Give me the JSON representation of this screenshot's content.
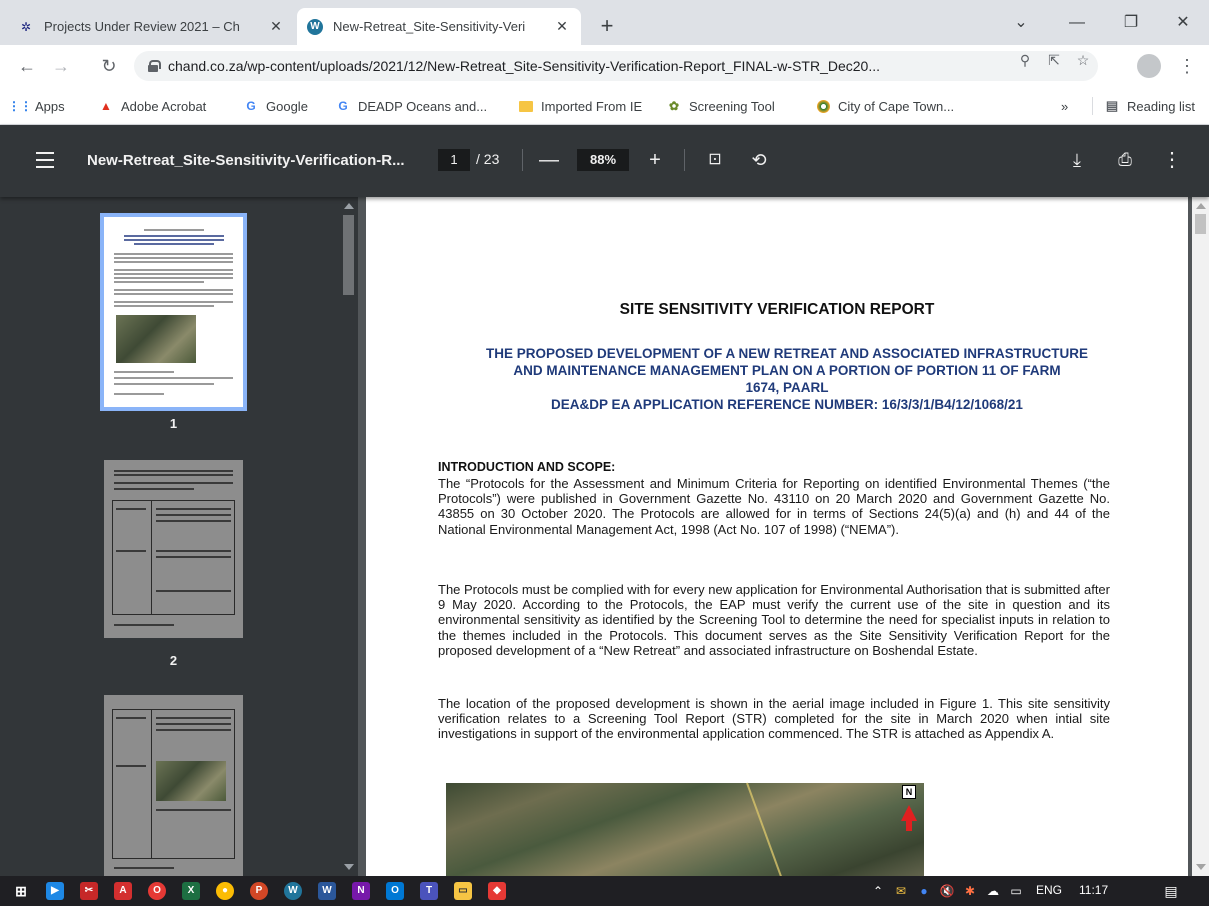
{
  "browser": {
    "tabs": [
      {
        "title": "Projects Under Review 2021 – Ch",
        "close": "✕"
      },
      {
        "title": "New-Retreat_Site-Sensitivity-Veri",
        "close": "✕"
      }
    ],
    "new_tab": "+",
    "window_controls": {
      "minimize": "—",
      "maximize": "❐",
      "close": "✕",
      "tab_search": "⌄"
    },
    "url": "chand.co.za/wp-content/uploads/2021/12/New-Retreat_Site-Sensitivity-Verification-Report_FINAL-w-STR_Dec20...",
    "bookmarks": [
      {
        "label": "Apps",
        "icon": "apps-grid-icon"
      },
      {
        "label": "Adobe Acrobat",
        "icon": "acrobat-icon"
      },
      {
        "label": "Google",
        "icon": "google-icon"
      },
      {
        "label": "DEADP Oceans and...",
        "icon": "google-icon"
      },
      {
        "label": "Imported From IE",
        "icon": "folder-icon"
      },
      {
        "label": "Screening Tool",
        "icon": "screening-tool-icon"
      },
      {
        "label": "City of Cape Town...",
        "icon": "city-cape-town-icon"
      }
    ],
    "bookmarks_more": "»",
    "reading_list": "Reading list"
  },
  "pdf_viewer": {
    "title": "New-Retreat_Site-Sensitivity-Verification-R...",
    "page_current": "1",
    "page_total": "/ 23",
    "zoom": "88%",
    "thumbnails": [
      {
        "number": "1"
      },
      {
        "number": "2"
      },
      {
        "number": "3"
      }
    ]
  },
  "document": {
    "title": "SITE SENSITIVITY VERIFICATION REPORT",
    "subtitle_lines": [
      "THE PROPOSED DEVELOPMENT OF A NEW RETREAT AND ASSOCIATED INFRASTRUCTURE",
      "AND MAINTENANCE MANAGEMENT PLAN ON A PORTION OF PORTION 11 OF FARM",
      "1674, PAARL",
      "DEA&DP EA APPLICATION REFERENCE NUMBER: 16/3/3/1/B4/12/1068/21"
    ],
    "section_heading": "INTRODUCTION AND SCOPE:",
    "paragraphs": [
      "The “Protocols for the Assessment and Minimum Criteria for Reporting on identified Environmental Themes (“the Protocols”) were published in Government Gazette No. 43110 on 20 March 2020 and Government Gazette No. 43855 on 30 October 2020. The Protocols are allowed for in terms of Sections 24(5)(a) and (h) and 44 of the National Environmental Management Act, 1998 (Act No. 107 of 1998) (“NEMA”).",
      "The Protocols must be complied with for every new application for Environmental Authorisation that is submitted after 9 May 2020. According to the Protocols, the EAP must verify the current use of the site in question and its environmental sensitivity as identified by the Screening Tool to determine the need for specialist inputs in relation to the themes included in the Protocols.  This document serves as the Site Sensitivity Verification Report for the proposed development of a “New Retreat” and associated infrastructure on Boshendal Estate.",
      "The location of the proposed development is shown in the aerial image included in Figure 1. This site sensitivity verification relates to a Screening Tool Report (STR) completed for the site in March 2020 when intial site investigations in support of the environmental application commenced.  The STR is attached as Appendix A."
    ],
    "figure_north_label": "N"
  },
  "taskbar": {
    "language": "ENG",
    "time": "11:17"
  }
}
